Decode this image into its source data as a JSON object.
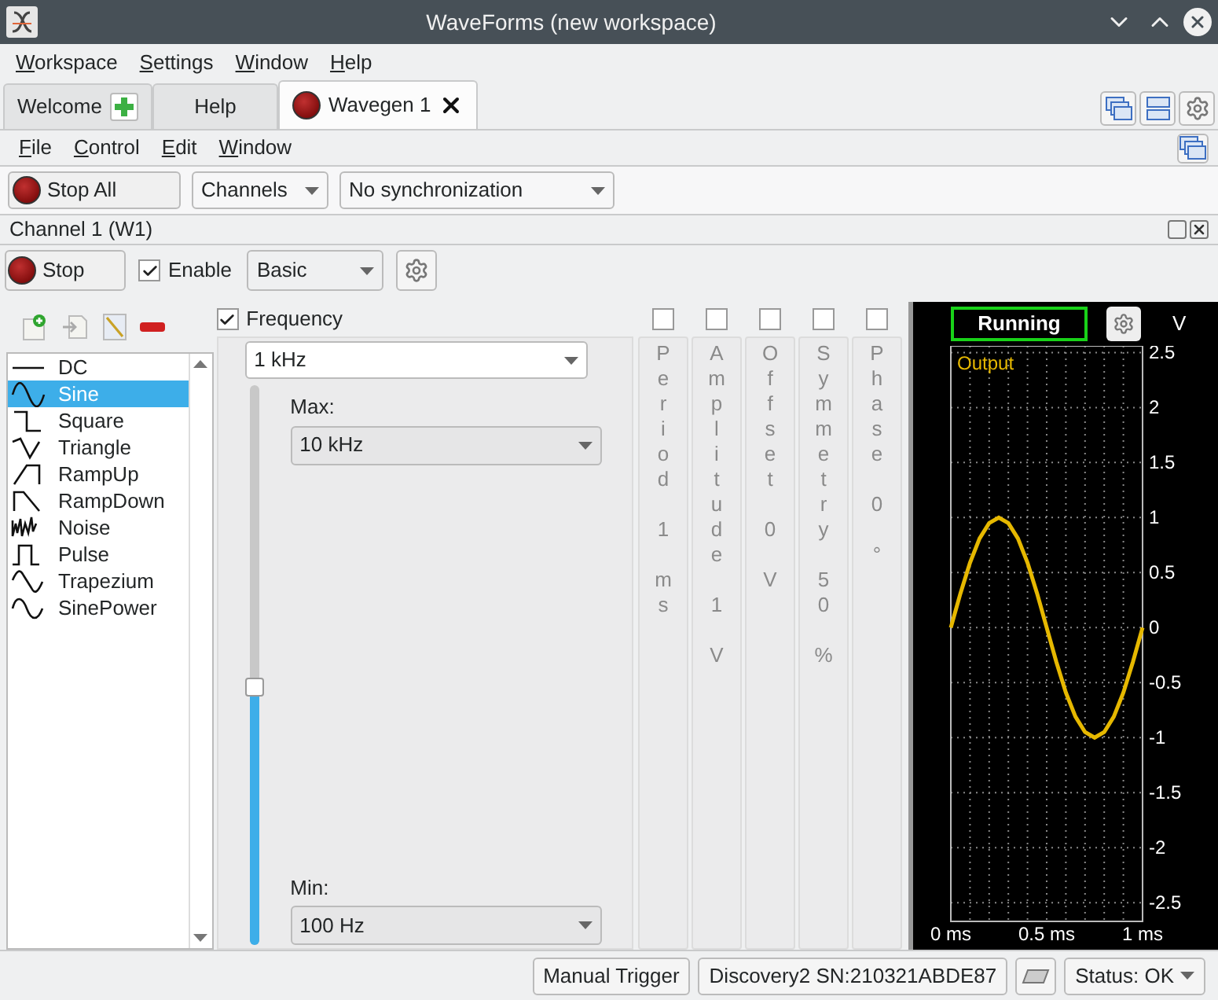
{
  "window": {
    "title": "WaveForms (new workspace)"
  },
  "menu": [
    "Workspace",
    "Settings",
    "Window",
    "Help"
  ],
  "tabs": [
    {
      "label": "Welcome",
      "kind": "welcome",
      "selected": false
    },
    {
      "label": "Help",
      "kind": "plain",
      "selected": false
    },
    {
      "label": "Wavegen 1",
      "kind": "instrument",
      "selected": true
    }
  ],
  "instrument_menu": [
    "File",
    "Control",
    "Edit",
    "Window"
  ],
  "toolbar": {
    "stop_all": "Stop All",
    "channels": "Channels",
    "sync": "No synchronization"
  },
  "channel": {
    "title": "Channel 1 (W1)",
    "stop": "Stop",
    "enable": {
      "label": "Enable",
      "checked": true
    },
    "mode": "Basic"
  },
  "waveforms": [
    {
      "label": "DC",
      "kind": "dc",
      "selected": false
    },
    {
      "label": "Sine",
      "kind": "sine",
      "selected": true
    },
    {
      "label": "Square",
      "kind": "square",
      "selected": false
    },
    {
      "label": "Triangle",
      "kind": "triangle",
      "selected": false
    },
    {
      "label": "RampUp",
      "kind": "rampup",
      "selected": false
    },
    {
      "label": "RampDown",
      "kind": "rampdown",
      "selected": false
    },
    {
      "label": "Noise",
      "kind": "noise",
      "selected": false
    },
    {
      "label": "Pulse",
      "kind": "pulse",
      "selected": false
    },
    {
      "label": "Trapezium",
      "kind": "trapezium",
      "selected": false
    },
    {
      "label": "SinePower",
      "kind": "sinepower",
      "selected": false
    }
  ],
  "frequency": {
    "label": "Frequency",
    "checked": true,
    "value": "1 kHz",
    "max_label": "Max:",
    "max": "10 kHz",
    "min_label": "Min:",
    "min": "100 Hz",
    "level": 0.46
  },
  "parameters": [
    {
      "name": "Period",
      "value": "1",
      "unit": "ms",
      "checked": false
    },
    {
      "name": "Amplitude",
      "value": "1",
      "unit": "V",
      "checked": false
    },
    {
      "name": "Offset",
      "value": "0",
      "unit": "V",
      "checked": false
    },
    {
      "name": "Symmetry",
      "value": "50",
      "unit": "%",
      "checked": false
    },
    {
      "name": "Phase",
      "value": "0",
      "unit": "°",
      "checked": false
    }
  ],
  "plot": {
    "status": "Running",
    "chart_data": {
      "type": "line",
      "ylabel": "V",
      "grid": true,
      "x": [
        0,
        0.05,
        0.1,
        0.15,
        0.2,
        0.25,
        0.3,
        0.35,
        0.4,
        0.45,
        0.5,
        0.55,
        0.6,
        0.65,
        0.7,
        0.75,
        0.8,
        0.85,
        0.9,
        0.95,
        1
      ],
      "series": [
        {
          "name": "Output",
          "color": "#e6b800",
          "values": [
            0,
            0.31,
            0.59,
            0.81,
            0.95,
            1,
            0.95,
            0.81,
            0.59,
            0.31,
            0,
            -0.31,
            -0.59,
            -0.81,
            -0.95,
            -1,
            -0.95,
            -0.81,
            -0.59,
            -0.31,
            0
          ]
        }
      ],
      "xlim": [
        0,
        1
      ],
      "ylim": [
        -2.67,
        2.56
      ],
      "xticks": [
        {
          "value": 0,
          "label": "0 ms"
        },
        {
          "value": 0.5,
          "label": "0.5 ms"
        },
        {
          "value": 1,
          "label": "1 ms"
        }
      ],
      "yticks": [
        2.5,
        2,
        1.5,
        1,
        0.5,
        0,
        -0.5,
        -1,
        -1.5,
        -2,
        -2.5
      ]
    }
  },
  "status_bar": {
    "manual_trigger": "Manual Trigger",
    "device": "Discovery2 SN:210321ABDE87",
    "status": "Status: OK"
  }
}
